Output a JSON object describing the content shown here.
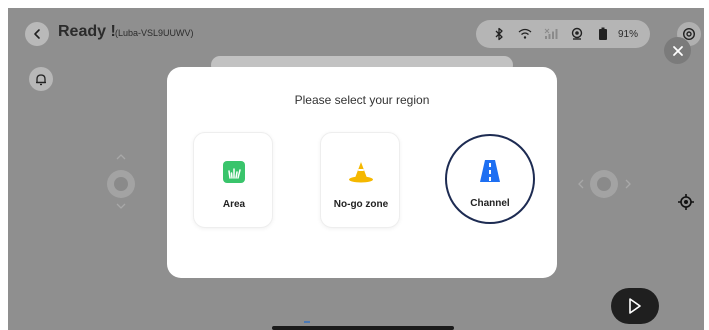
{
  "header": {
    "title": "Ready !",
    "subtitle": "(Luba-VSL9UUWV)",
    "battery": "91%"
  },
  "icons": {
    "back": "chevron-left-icon",
    "bluetooth": "bluetooth-icon",
    "wifi": "wifi-icon",
    "signal": "cellular-signal-icon",
    "rtk": "gps-icon",
    "battery": "battery-icon",
    "settings": "settings-icon",
    "close": "close-icon",
    "bell": "bell-icon",
    "locate": "locate-icon",
    "play": "play-icon"
  },
  "modal": {
    "title": "Please select your region",
    "options": [
      {
        "label": "Area",
        "icon": "grass-area-icon",
        "color": "#39c46b",
        "selected": false
      },
      {
        "label": "No-go zone",
        "icon": "traffic-cone-icon",
        "color": "#f5b800",
        "selected": false
      },
      {
        "label": "Channel",
        "icon": "road-channel-icon",
        "color": "#1e6ff2",
        "selected": true
      }
    ]
  },
  "colors": {
    "overlay": "#8f8f8f",
    "selected_ring": "#1d2b52",
    "play_button": "#1f1f1f"
  }
}
